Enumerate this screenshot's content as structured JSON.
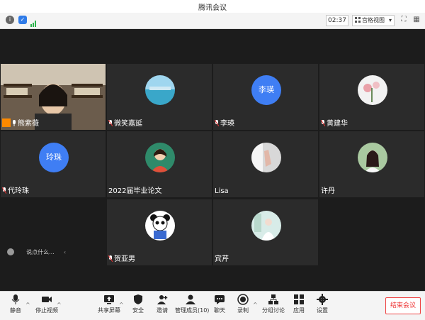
{
  "window": {
    "title": "腾讯会议"
  },
  "infobar": {
    "timer": "02:37",
    "view_mode": "宫格视图"
  },
  "participants": [
    {
      "name": "熊紫薇",
      "avatar": "camera-video",
      "col": 0,
      "row": 0
    },
    {
      "name": "微笑嘉延",
      "avatar": "ocean-photo",
      "col": 1,
      "row": 0
    },
    {
      "name": "李瑛",
      "avatar_text": "李瑛",
      "col": 2,
      "row": 0
    },
    {
      "name": "黄建华",
      "avatar": "flowers-photo",
      "col": 3,
      "row": 0
    },
    {
      "name": "代玲珠",
      "avatar_text": "玲珠",
      "col": 0,
      "row": 1
    },
    {
      "name": "2022届毕业论文",
      "avatar": "cartoon-girl",
      "col": 1,
      "row": 1
    },
    {
      "name": "Lisa",
      "avatar": "hand-photo",
      "col": 2,
      "row": 1
    },
    {
      "name": "许丹",
      "avatar": "girl-photo",
      "col": 3,
      "row": 1
    },
    {
      "name": "贺亚男",
      "avatar": "panda-cartoon",
      "col": 1,
      "row": 2
    },
    {
      "name": "宾芹",
      "avatar": "bride-photo",
      "col": 2,
      "row": 2
    }
  ],
  "chat": {
    "placeholder": "说点什么..."
  },
  "toolbar": {
    "mute": "静音",
    "stop_video": "停止视频",
    "share_screen": "共享屏幕",
    "security": "安全",
    "invite": "邀请",
    "manage_members": "管理成员(10)",
    "chat": "聊天",
    "record": "录制",
    "breakout": "分组讨论",
    "apps": "应用",
    "settings": "设置",
    "end_meeting": "结束会议"
  }
}
